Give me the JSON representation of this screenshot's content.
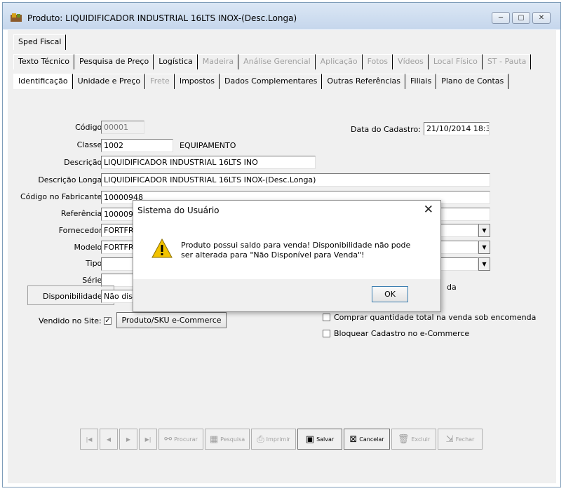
{
  "window": {
    "title": "Produto: LIQUIDIFICADOR INDUSTRIAL 16LTS INOX-(Desc.Longa)",
    "controls": [
      "─",
      "▢",
      "✕"
    ]
  },
  "tabs": {
    "row1": [
      {
        "label": "Sped Fiscal",
        "disabled": false
      }
    ],
    "row2": [
      {
        "label": "Texto Técnico",
        "disabled": false
      },
      {
        "label": "Pesquisa de Preço",
        "disabled": false
      },
      {
        "label": "Logística",
        "disabled": false
      },
      {
        "label": "Madeira",
        "disabled": true
      },
      {
        "label": "Análise Gerencial",
        "disabled": true
      },
      {
        "label": "Aplicação",
        "disabled": true
      },
      {
        "label": "Fotos",
        "disabled": true
      },
      {
        "label": "Vídeos",
        "disabled": true
      },
      {
        "label": "Local Físico",
        "disabled": true
      },
      {
        "label": "ST - Pauta",
        "disabled": true
      }
    ],
    "row3": [
      {
        "label": "Identificação",
        "disabled": false,
        "active": true
      },
      {
        "label": "Unidade e Preço",
        "disabled": false
      },
      {
        "label": "Frete",
        "disabled": true
      },
      {
        "label": "Impostos",
        "disabled": false
      },
      {
        "label": "Dados Complementares",
        "disabled": false
      },
      {
        "label": "Outras Referências",
        "disabled": false
      },
      {
        "label": "Filiais",
        "disabled": false
      },
      {
        "label": "Plano de Contas",
        "disabled": false
      }
    ]
  },
  "form": {
    "codigo": {
      "label": "Código:",
      "value": "00001"
    },
    "data_cadastro": {
      "label": "Data do Cadastro:",
      "value": "21/10/2014 18:3"
    },
    "classe": {
      "label": "Classe:",
      "value": "1002",
      "desc": "EQUIPAMENTO"
    },
    "descricao": {
      "label": "Descrição:",
      "value": "LIQUIDIFICADOR INDUSTRIAL 16LTS INO"
    },
    "descricao_longa": {
      "label": "Descrição Longa:",
      "value": "LIQUIDIFICADOR INDUSTRIAL 16LTS INOX-(Desc.Longa)"
    },
    "codigo_fabricante": {
      "label": "Código no Fabricante:",
      "value": "10000948"
    },
    "referencia": {
      "label": "Referência:",
      "value": "1000094"
    },
    "fornecedor": {
      "label": "Fornecedor:",
      "value": "FORTFR"
    },
    "modelo": {
      "label": "Modelo:",
      "value": "FORTFR"
    },
    "tipo": {
      "label": "Tipo:",
      "value": ""
    },
    "serie": {
      "label": "Série:",
      "value": ""
    },
    "disponibilidade": {
      "label": "Disponibilidade:",
      "value": "Não disp"
    },
    "vendido_site": {
      "label": "Vendido no Site:",
      "checked": true
    },
    "produto_sku_button": "Produto/SKU e-Commerce",
    "partial_right_text": "da",
    "comprar_qtd": {
      "label": "Comprar quantidade total na venda sob encomenda",
      "checked": false
    },
    "bloquear": {
      "label": "Bloquear Cadastro no e-Commerce",
      "checked": false
    }
  },
  "toolbar": {
    "first": "|◀",
    "prev": "◀",
    "next": "▶",
    "last": "▶|",
    "procurar": "Procurar",
    "pesquisa": "Pesquisa",
    "imprimir": "Imprimir",
    "salvar": "Salvar",
    "cancelar": "Cancelar",
    "excluir": "Excluir",
    "fechar": "Fechar"
  },
  "dialog": {
    "title": "Sistema do Usuário",
    "close": "✕",
    "message_line1": "Produto possui saldo para venda! Disponibilidade não pode",
    "message_line2": "ser alterada para \"Não Disponível para Venda\"!",
    "ok": "OK"
  },
  "colors": {
    "titlebar": "#c5d6ec",
    "background": "#f0f0f0",
    "warning": "#f2c300"
  }
}
